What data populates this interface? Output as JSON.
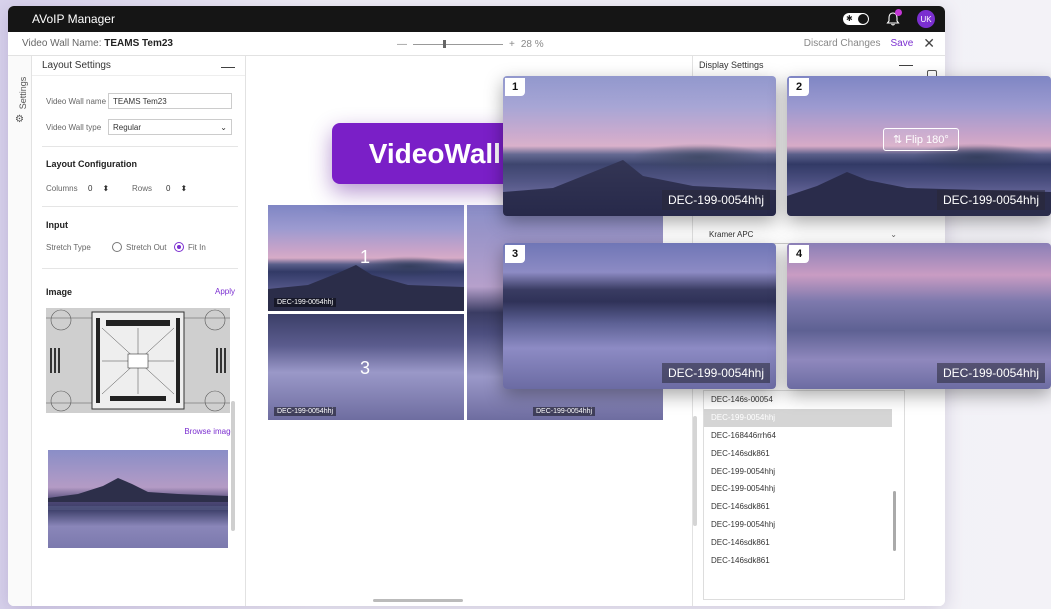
{
  "app": {
    "title": "AVoIP Manager",
    "avatar_initials": "UK"
  },
  "subbar": {
    "video_wall_label": "Video Wall Name:",
    "video_wall_name": "TEAMS Tem23",
    "zoom_minus": "—",
    "zoom_plus": "+",
    "zoom_value": "28 %",
    "discard_label": "Discard Changes",
    "save_label": "Save",
    "close_label": "✕"
  },
  "sidetab": {
    "label": "Settings"
  },
  "layout_settings": {
    "title": "Layout Settings",
    "collapse": "—",
    "wall_name_label": "Video Wall name",
    "wall_name_value": "TEAMS Tem23",
    "wall_type_label": "Video Wall type",
    "wall_type_value": "Regular",
    "layout_config_title": "Layout Configuration",
    "columns_label": "Columns",
    "columns_value": "0",
    "rows_label": "Rows",
    "rows_value": "0",
    "input_title": "Input",
    "stretch_type_label": "Stretch Type",
    "stretch_out_label": "Stretch Out",
    "fit_in_label": "Fit In",
    "image_title": "Image",
    "apply_label": "Apply",
    "browse_label": "Browse image"
  },
  "canvas": {
    "tiles": [
      {
        "num": "1",
        "label": "DEC-199-0054hhj"
      },
      {
        "num": "3",
        "label": "DEC-199-0054hhj"
      },
      {
        "num": "",
        "label": "DEC-199-0054hhj"
      }
    ]
  },
  "banner": {
    "text": "VideoWall Grid"
  },
  "big_tiles": [
    {
      "badge": "1",
      "caption": "DEC-199-0054hhj"
    },
    {
      "badge": "2",
      "caption": "DEC-199-0054hhj",
      "flip": "Flip 180°"
    },
    {
      "badge": "3",
      "caption": "DEC-199-0054hhj"
    },
    {
      "badge": "4",
      "caption": "DEC-199-0054hhj"
    }
  ],
  "display_settings": {
    "title": "Display Settings",
    "collapse": "—",
    "dropdown_value": "Kramer APC",
    "list": [
      "DEC-146s-00054",
      "DEC-199-0054hhj",
      "DEC-168446rrh64",
      "DEC-146sdk861",
      "DEC-199-0054hhj",
      "DEC-199-0054hhj",
      "DEC-146sdk861",
      "DEC-199-0054hhj",
      "DEC-146sdk861",
      "DEC-146sdk861"
    ],
    "selected_index": 1
  },
  "colors": {
    "accent": "#7b2fd0",
    "banner": "#7a1fc7",
    "titlebar": "#151515"
  }
}
